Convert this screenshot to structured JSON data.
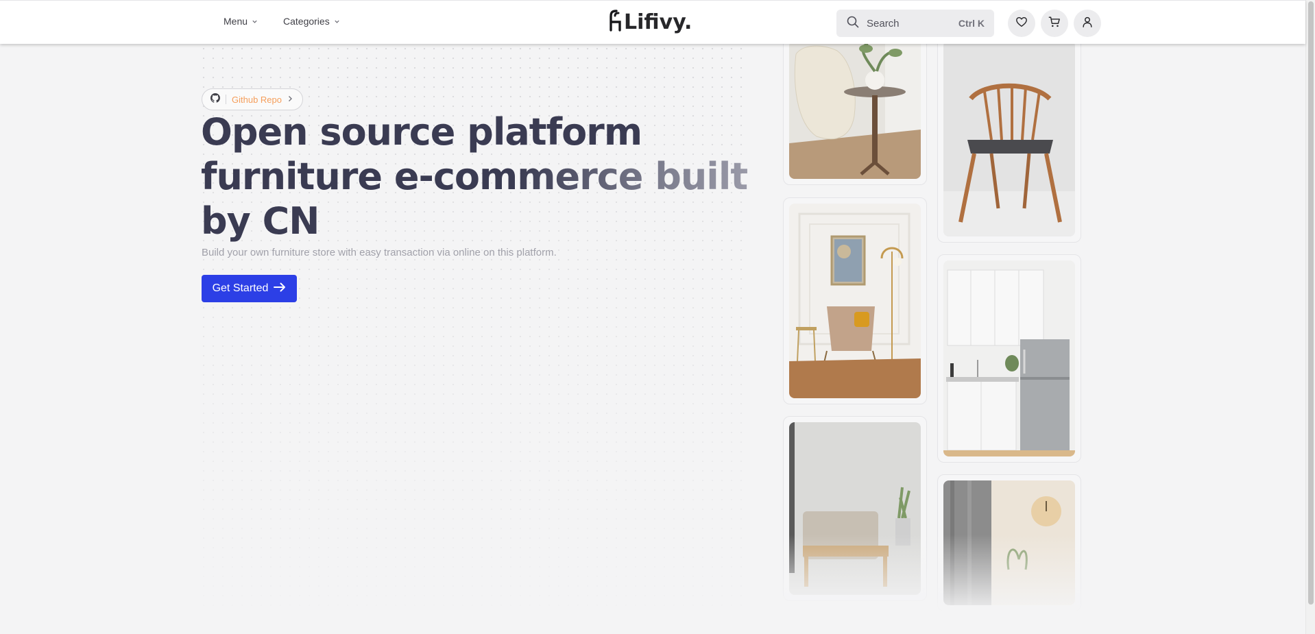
{
  "header": {
    "menu_label": "Menu",
    "categories_label": "Categories",
    "brand": "Lifivy.",
    "search_placeholder": "Search",
    "search_shortcut": "Ctrl K",
    "icons": [
      "search-icon",
      "heart-icon",
      "cart-icon",
      "user-icon",
      "chevron-down-icon"
    ]
  },
  "hero": {
    "badge_label": "Github Repo",
    "headline_part1": "Open source platform furniture e-com",
    "headline_part2": "merce built",
    "headline_part3": "by CN",
    "subtitle": "Build your own furniture store with easy transaction via online on this platform.",
    "cta_label": "Get Started",
    "accent_color": "#2c3fe6",
    "badge_text_color": "#f59e5b"
  },
  "gallery": {
    "images": [
      "egg-chair-with-side-table",
      "wooden-spindle-chair",
      "lounge-chair-with-floor-lamp",
      "white-kitchen-with-fridge",
      "armchair-by-concrete-wall",
      "room-with-curtain-and-clock"
    ]
  }
}
